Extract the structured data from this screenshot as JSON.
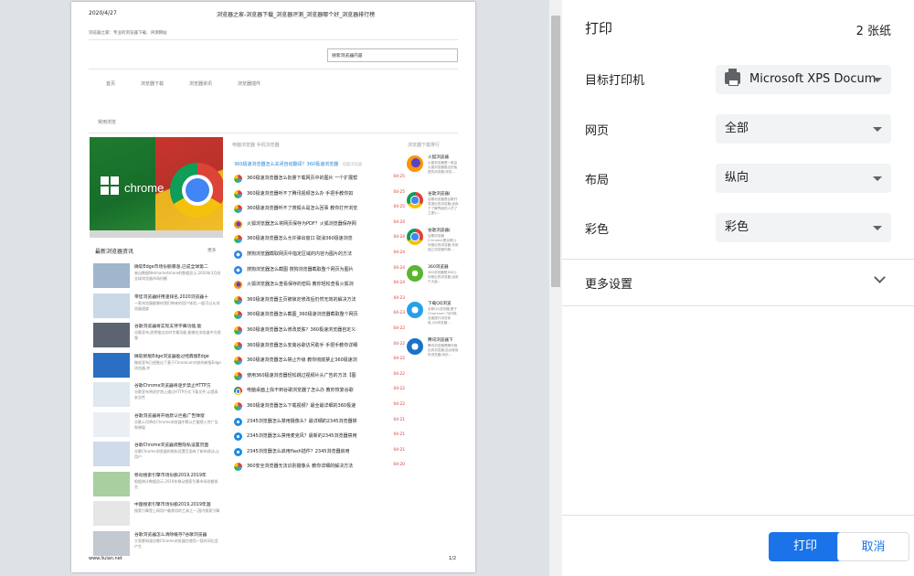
{
  "preview": {
    "header_date": "2020/4/27",
    "header_title": "浏览器之家-浏览器下载_浏览器评测_浏览器哪个好_浏览器排行榜",
    "site_note": "浏览器之家：专业的浏览器下载、评测网站",
    "search_placeholder": "搜索浏览器内容",
    "nav": [
      "首页",
      "浏览器下载",
      "浏览器资讯",
      "浏览器插件"
    ],
    "breadcrumb": "常用浏览",
    "banner_word": "chrome",
    "latest_news_title": "最新浏览器资讯",
    "latest_news_more": "更多",
    "latest_news": [
      {
        "title": "微软Edge市场份额暴涨,已成全球第二",
        "desc": "来自数据Netmarketshare的数据显示,2020年3月份全球浏览器市场份额"
      },
      {
        "title": "带您浏览器好用速排名,2020浏览器十",
        "desc": "一款浏览器能够给我们带来的用户体验,一般可以从浏览器速度"
      },
      {
        "title": "谷歌浏览器将实现支持字幕功能,能",
        "desc": "谷歌宣布,即将推出实时字幕功能,能够在浏览器中为视频"
      },
      {
        "title": "微软新版Edge浏览器能过经典版Edge",
        "desc": "微软宣布已经推出了基于Chromium内核的新版Edge浏览器,并"
      },
      {
        "title": "谷歌Chrome浏览器将逐步禁止HTTP方",
        "desc": "谷歌宣布将逐步禁止通过HTTP方式下载文件,以提高安全性"
      },
      {
        "title": "谷歌浏览器将开始默认拦截广告弹窗",
        "desc": "谷歌公司将在Chrome浏览器中默认拦截侵入性广告和弹窗"
      },
      {
        "title": "谷歌Chrome浏览器调整隐私设置页面",
        "desc": "谷歌Chrome浏览器的隐私设置页面有了新的改动,让用户"
      },
      {
        "title": "移动搜索引擎市场份额2019,2019年",
        "desc": "根据统计数据显示,2019年移动搜索引擎市场份额排名"
      },
      {
        "title": "中国搜索引擎市场份额2019,2019年国",
        "desc": "搜索引擎是上网用户最常用的工具之一,国内搜索引擎"
      },
      {
        "title": "谷歌浏览器怎么清除缓存?谷歌浏览器",
        "desc": "大家都知道谷歌Chrome浏览器在使用一段时间后会产生"
      }
    ],
    "tabs": "电脑浏览器    手机浏览器",
    "featured": "360极速浏览器怎么关闭自动翻译？360极速浏览器",
    "featured_tag": "电脑浏览器",
    "main_list": [
      {
        "icon": "q360",
        "text": "360极速浏览器怎么批量下载网页中的图片 一个扩展帮",
        "date": "04-25"
      },
      {
        "icon": "q360",
        "text": "360极速浏览器听不了腾讯视频怎么办 手把手教你如",
        "date": "04-25"
      },
      {
        "icon": "q360",
        "text": "360极速浏览器听不了搜狐头是怎么回事 教你打开浏览",
        "date": "04-25"
      },
      {
        "icon": "ff",
        "text": "火狐浏览器怎么将网页保存为PDF？火狐浏览器保存网",
        "date": "04-24"
      },
      {
        "icon": "q360",
        "text": "360极速浏览器怎么允许弹出窗口 取消360极速浏览",
        "date": "04-24"
      },
      {
        "icon": "sog",
        "text": "搜狗浏览器截取网页中指定区域的内容为图片的方法",
        "date": "04-24"
      },
      {
        "icon": "sog",
        "text": "搜狗浏览器怎么截图 搜狗浏览器截取整个网页为图片",
        "date": "04-24"
      },
      {
        "icon": "ff",
        "text": "火狐浏览器怎么查看保存的密码 教你轻松查看火狐浏",
        "date": "04-24"
      },
      {
        "icon": "q360",
        "text": "360极速浏览器主页被锁定修改后仍然无效的解决方法",
        "date": "04-23"
      },
      {
        "icon": "q360",
        "text": "360极速浏览器怎么截图_360极速浏览器截取整个网页",
        "date": "04-23"
      },
      {
        "icon": "q360",
        "text": "360极速浏览器怎么修改皮肤？360极速浏览器自定义",
        "date": "04-22"
      },
      {
        "icon": "q360",
        "text": "360极速浏览器怎么安装谷歌访问助手 手把手教你详细",
        "date": "04-22"
      },
      {
        "icon": "q360",
        "text": "360极速浏览器怎么禁止升级 教你彻底禁止360极速浏",
        "date": "04-22"
      },
      {
        "icon": "q360",
        "text": "使用360极速浏览器轻松跳过视频片头广告的方法【图",
        "date": "04-22"
      },
      {
        "icon": "ch",
        "text": "电脑桌面上找不到谷歌浏览器了怎么办 教你恢复谷歌",
        "date": "04-22"
      },
      {
        "icon": "q360",
        "text": "360极速浏览器怎么下载视频？最全最详细的360极速",
        "date": "04-22"
      },
      {
        "icon": "ie",
        "text": "2345浏览器怎么禁用摄像头？最详细的2345浏览器禁",
        "date": "04-21"
      },
      {
        "icon": "ie",
        "text": "2345浏览器怎么禁用麦克风？最新的2345浏览器禁用",
        "date": "04-21"
      },
      {
        "icon": "ie",
        "text": "2345浏览器怎么启用flash插件？2345浏览器启用",
        "date": "04-21"
      },
      {
        "icon": "q360",
        "text": "360安全浏览器无法识别摄像头 教你详细的解决方法",
        "date": "04-20"
      }
    ],
    "ranking_title": "浏览器下载排行",
    "ranking": [
      {
        "icon": "ff",
        "title": "火狐浏览器",
        "desc": "火狐浏览器是一款由火狐浏览器推出的免费的浏览器,特性…"
      },
      {
        "icon": "ch",
        "title": "谷歌浏览器(",
        "desc": "谷歌浏览器是谷歌开发推出的浏览器,适用于了解界面的人员了之更小…"
      },
      {
        "icon": "ch",
        "title": "谷歌浏览器(",
        "desc": "谷歌浏览器(Chrome)是谷歌公司推出的浏览器,采用独立浏览器内核…"
      },
      {
        "icon": "ie360",
        "title": "360浏览器",
        "desc": "360浏览器是360公司推出的浏览器,适用于大量…"
      },
      {
        "icon": "qq",
        "title": "下载QQ浏览",
        "desc": "全新QQ浏览器,基于Chromium 78内核,全面提升浏览体验,QQ浏览器…"
      },
      {
        "icon": "edge",
        "title": "腾讯浏览器下",
        "desc": "腾讯浏览器是腾讯推出的浏览器,结合使用的浏览器,网页…"
      }
    ],
    "footer_url": "www.liulan.net",
    "footer_page": "1/2"
  },
  "panel": {
    "title": "打印",
    "sheets": "2 张纸",
    "rows": [
      {
        "label": "目标打印机",
        "value": "Microsoft XPS Docum",
        "icon": "printer-icon"
      },
      {
        "label": "网页",
        "value": "全部"
      },
      {
        "label": "布局",
        "value": "纵向"
      },
      {
        "label": "彩色",
        "value": "彩色"
      }
    ],
    "more_settings": "更多设置",
    "print_button": "打印",
    "cancel_button": "取消",
    "accent_color": "#1a73e8"
  }
}
